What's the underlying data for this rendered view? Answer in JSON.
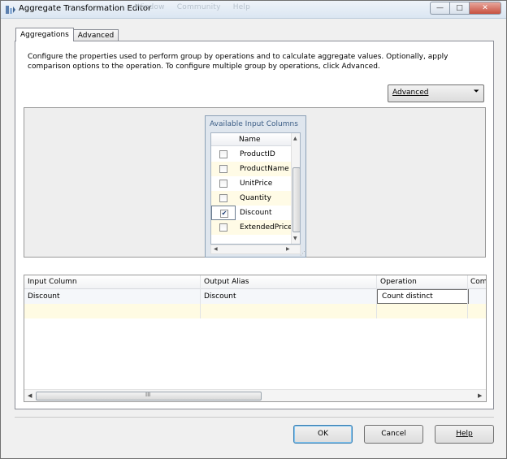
{
  "window": {
    "title": "Aggregate Transformation Editor",
    "ghost_menu": [
      "Window",
      "Community",
      "Help"
    ],
    "controls": {
      "minimize": "—",
      "maximize": "□",
      "close": "✕"
    }
  },
  "tabs": [
    {
      "label": "Aggregations",
      "active": true
    },
    {
      "label": "Advanced",
      "active": false
    }
  ],
  "description": "Configure the properties used to perform group by operations and to calculate aggregate values. Optionally, apply comparison options to the operation. To configure multiple group by operations, click Advanced.",
  "advanced_combo": {
    "label": "Advanced",
    "arrow": "⏷"
  },
  "input_columns": {
    "title": "Available Input Columns",
    "header": "Name",
    "items": [
      {
        "name": "ProductID",
        "checked": false
      },
      {
        "name": "ProductName",
        "checked": false
      },
      {
        "name": "UnitPrice",
        "checked": false
      },
      {
        "name": "Quantity",
        "checked": false
      },
      {
        "name": "Discount",
        "checked": true
      },
      {
        "name": "ExtendedPrice",
        "checked": false
      }
    ]
  },
  "grid": {
    "headers": [
      "Input Column",
      "Output Alias",
      "Operation",
      "Com"
    ],
    "rows": [
      {
        "input_column": "Discount",
        "output_alias": "Discount",
        "operation": "Count distinct"
      }
    ],
    "scroll_grip": "III"
  },
  "buttons": {
    "ok": "OK",
    "cancel": "Cancel",
    "help": "Help"
  }
}
